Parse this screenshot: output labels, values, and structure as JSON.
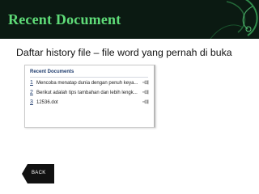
{
  "slide": {
    "title": "Recent Document",
    "subtitle": "Daftar history file – file word yang pernah di buka"
  },
  "recent_panel": {
    "title": "Recent Documents",
    "items": [
      {
        "number": "1",
        "name": "Mencoba menatap dunia dengan penuh keya..."
      },
      {
        "number": "2",
        "name": "Berikut adalah tips tambahan dan lebih lengk..."
      },
      {
        "number": "3",
        "name": "12536.dot"
      }
    ]
  },
  "back_button": {
    "label": "BACK"
  },
  "colors": {
    "header_bg": "#0b1a12",
    "title_green": "#5fdc78",
    "panel_title_blue": "#1f3c6e"
  }
}
